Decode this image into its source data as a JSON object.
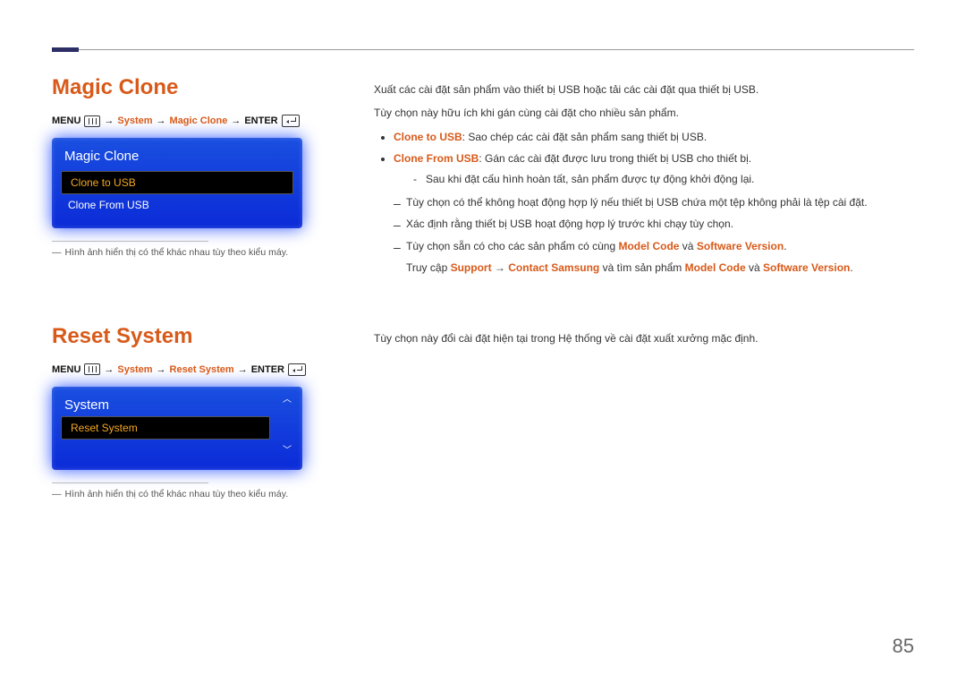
{
  "pageNumber": "85",
  "section1": {
    "title": "Magic Clone",
    "breadcrumb": {
      "menu": "MENU",
      "item1": "System",
      "item2": "Magic Clone",
      "enter": "ENTER"
    },
    "osd": {
      "title": "Magic Clone",
      "item_selected": "Clone to USB",
      "item2": "Clone From USB"
    },
    "note": "Hình ảnh hiển thị có thể khác nhau tùy theo kiểu máy.",
    "desc1": "Xuất các cài đặt sản phẩm vào thiết bị USB hoặc tải các cài đặt qua thiết bị USB.",
    "desc2": "Tùy chọn này hữu ích khi gán cùng cài đặt cho nhiều sản phẩm.",
    "b1_label": "Clone to USB",
    "b1_text": ": Sao chép các cài đặt sản phẩm sang thiết bị USB.",
    "b2_label": "Clone From USB",
    "b2_text": ": Gán các cài đặt được lưu trong thiết bị USB cho thiết bị.",
    "b2_sub": "Sau khi đặt cấu hình hoàn tất, sản phẩm được tự động khởi động lại.",
    "dash1": "Tùy chọn có thể không hoạt động hợp lý nếu thiết bị USB chứa một tệp không phải là tệp cài đặt.",
    "dash2": "Xác định rằng thiết bị USB hoạt động hợp lý trước khi chạy tùy chọn.",
    "dash3_a": "Tùy chọn sẵn có cho các sản phẩm có cùng ",
    "dash3_b": "Model Code",
    "dash3_c": " và ",
    "dash3_d": "Software Version",
    "dash3_e": ".",
    "dash3_sub_a": "Truy cập ",
    "dash3_sub_b": "Support",
    "dash3_sub_c": " → ",
    "dash3_sub_d": "Contact Samsung",
    "dash3_sub_e": " và tìm sản phẩm ",
    "dash3_sub_f": "Model Code",
    "dash3_sub_g": " và ",
    "dash3_sub_h": "Software Version",
    "dash3_sub_i": "."
  },
  "section2": {
    "title": "Reset System",
    "breadcrumb": {
      "menu": "MENU",
      "item1": "System",
      "item2": "Reset System",
      "enter": "ENTER"
    },
    "osd": {
      "title": "System",
      "item_selected": "Reset System"
    },
    "note": "Hình ảnh hiển thị có thể khác nhau tùy theo kiểu máy.",
    "desc": "Tùy chọn này đổi cài đặt hiện tại trong Hệ thống về cài đặt xuất xưởng mặc định."
  }
}
